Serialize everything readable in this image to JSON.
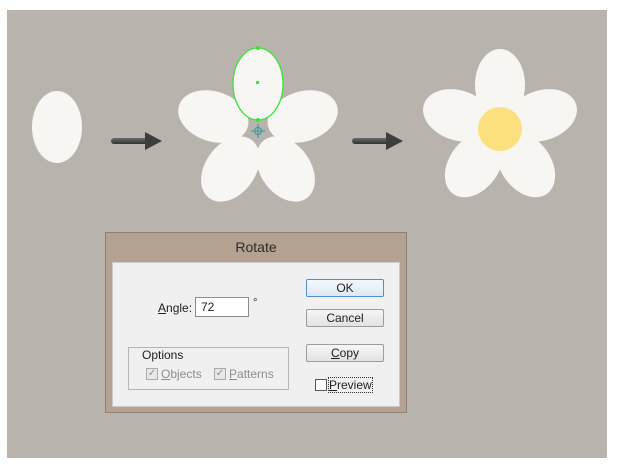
{
  "dialog": {
    "title": "Rotate",
    "angle_label_first": "A",
    "angle_label_rest": "ngle:",
    "angle_value": "72",
    "degree_symbol": "°",
    "buttons": {
      "ok": "OK",
      "cancel": "Cancel",
      "copy_first": "C",
      "copy_rest": "opy"
    },
    "options": {
      "legend": "Options",
      "objects_first": "O",
      "objects_rest": "bjects",
      "objects_checked": true,
      "patterns_first": "P",
      "patterns_rest": "atterns",
      "patterns_checked": true
    },
    "preview_first": "P",
    "preview_rest": "review",
    "preview_checked": false
  },
  "colors": {
    "canvas": "#b8b3ad",
    "petal": "#f8f6f3",
    "selection": "#39e339",
    "flower_center": "#fde07e",
    "arrow": "#4a4a48"
  }
}
